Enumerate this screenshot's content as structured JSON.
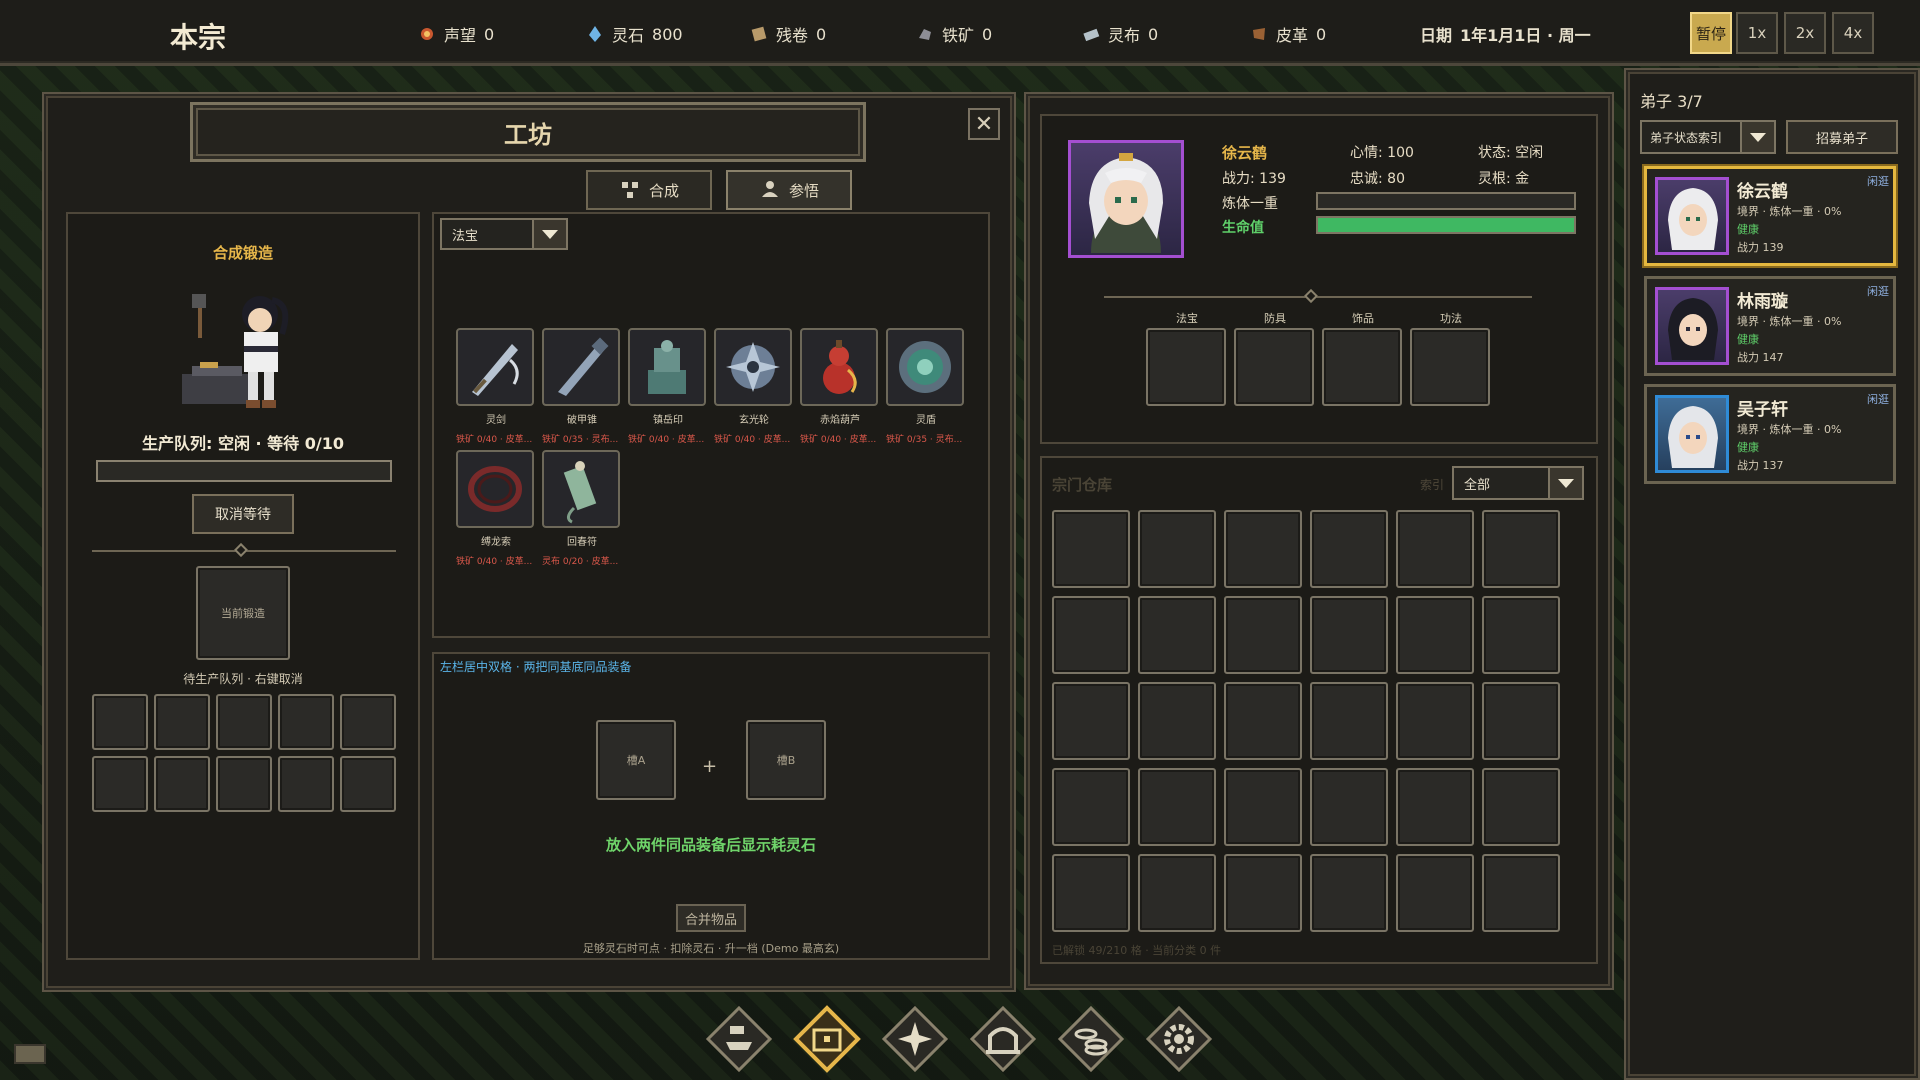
{
  "topbar": {
    "sect_name": "本宗",
    "resources": [
      {
        "icon": "prestige-icon",
        "label": "声望",
        "value": "0"
      },
      {
        "icon": "spirit-stone-icon",
        "label": "灵石",
        "value": "800"
      },
      {
        "icon": "scroll-icon",
        "label": "残卷",
        "value": "0"
      },
      {
        "icon": "iron-ore-icon",
        "label": "铁矿",
        "value": "0"
      },
      {
        "icon": "spirit-cloth-icon",
        "label": "灵布",
        "value": "0"
      },
      {
        "icon": "leather-icon",
        "label": "皮革",
        "value": "0"
      }
    ],
    "date_label": "日期",
    "date_value": "1年1月1日 · 周一",
    "speeds": [
      "暂停",
      "1x",
      "2x",
      "4x"
    ],
    "active_speed": "暂停"
  },
  "workshop": {
    "title": "工坊",
    "tabs": [
      "合成",
      "参悟"
    ],
    "left": {
      "heading": "合成锻造",
      "queue_status": "生产队列: 空闲 · 等待 0/10",
      "cancel_button": "取消等待",
      "current_slot": "当前锻造",
      "queue_hint": "待生产队列 · 右键取消"
    },
    "category_dropdown": "法宝",
    "items": [
      {
        "name": "灵剑",
        "req": "铁矿 0/40 · 皮革...",
        "icon": "spirit-sword-icon"
      },
      {
        "name": "破甲锥",
        "req": "铁矿 0/35 · 灵布...",
        "icon": "armor-piercer-icon"
      },
      {
        "name": "镇岳印",
        "req": "铁矿 0/40 · 皮革...",
        "icon": "mountain-seal-icon"
      },
      {
        "name": "玄光轮",
        "req": "铁矿 0/40 · 皮革...",
        "icon": "light-wheel-icon"
      },
      {
        "name": "赤焰葫芦",
        "req": "铁矿 0/40 · 皮革...",
        "icon": "flame-gourd-icon"
      },
      {
        "name": "灵盾",
        "req": "铁矿 0/35 · 灵布...",
        "icon": "spirit-shield-icon"
      },
      {
        "name": "缚龙索",
        "req": "铁矿 0/40 · 皮革...",
        "icon": "dragon-rope-icon"
      },
      {
        "name": "回春符",
        "req": "灵布 0/20 · 皮革...",
        "icon": "heal-talisman-icon"
      }
    ],
    "merge": {
      "hint": "左栏居中双格 · 两把同基底同品装备",
      "slot_a": "槽A",
      "slot_b": "槽B",
      "plus": "+",
      "message": "放入两件同品装备后显示耗灵石",
      "button": "合并物品",
      "footer": "足够灵石时可点 · 扣除灵石 · 升一档 (Demo 最高玄)"
    }
  },
  "disciple_detail": {
    "name": "徐云鹤",
    "power": "战力: 139",
    "mood": "心情: 100",
    "loyalty": "忠诚: 80",
    "state": "状态: 空闲",
    "root": "灵根: 金",
    "realm": "炼体一重",
    "hp_label": "生命值",
    "realm_progress": 0,
    "hp_progress": 1.0,
    "equip_slots": [
      "法宝",
      "防具",
      "饰品",
      "功法"
    ]
  },
  "warehouse": {
    "title": "宗门仓库",
    "filter_label": "索引",
    "filter_value": "全部",
    "footer": "已解锁 49/210 格 · 当前分类 0 件"
  },
  "disciples": {
    "header": "弟子 3/7",
    "filter": "弟子状态索引",
    "recruit": "招募弟子",
    "list": [
      {
        "name": "徐云鹤",
        "tag": "闲逛",
        "realm": "境界 · 炼体一重 · 0%",
        "health": "健康",
        "power": "战力 139"
      },
      {
        "name": "林雨璇",
        "tag": "闲逛",
        "realm": "境界 · 炼体一重 · 0%",
        "health": "健康",
        "power": "战力 147"
      },
      {
        "name": "吴子轩",
        "tag": "闲逛",
        "realm": "境界 · 炼体一重 · 0%",
        "health": "健康",
        "power": "战力 137"
      }
    ]
  },
  "colors": {
    "accent": "#e6b64a",
    "hp": "#3fb862",
    "req": "#d8574a",
    "portrait_border": "#a44fd1"
  }
}
